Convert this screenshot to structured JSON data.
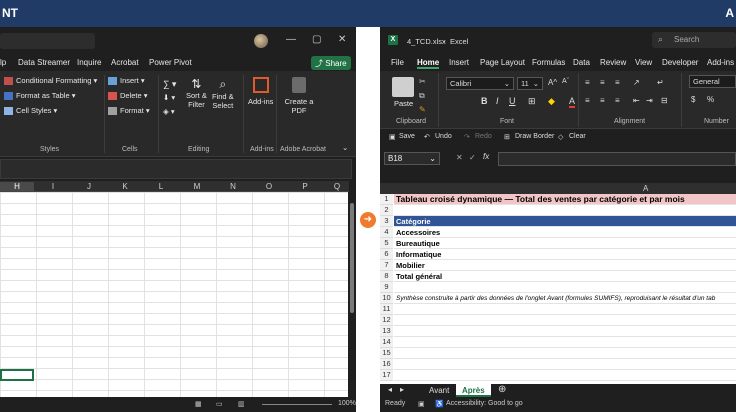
{
  "banner": {
    "left_text": "NT",
    "right_text": "A"
  },
  "left_window": {
    "menu": [
      "lp",
      "Data Streamer",
      "Inquire",
      "Acrobat",
      "Power Pivot"
    ],
    "share_label": "Share",
    "ribbon": {
      "styles_items": [
        "Conditional Formatting",
        "Format as Table",
        "Cell Styles"
      ],
      "cells_items": [
        "Insert",
        "Delete",
        "Format"
      ],
      "editing_items": [
        "Sort &",
        "Filter",
        "Find &",
        "Select"
      ],
      "addins_label": "Add-ins",
      "acrobat_label": "Create a PDF",
      "groups": [
        "Styles",
        "Cells",
        "Editing",
        "Add-ins",
        "Adobe Acrobat"
      ]
    },
    "columns": [
      "H",
      "I",
      "J",
      "K",
      "L",
      "M",
      "N",
      "O",
      "P",
      "Q"
    ],
    "status_zoom": "100%"
  },
  "right_window": {
    "filename": "4_TCD.xlsx",
    "app": "Excel",
    "search_placeholder": "Search",
    "menu": [
      "File",
      "Home",
      "Insert",
      "Page Layout",
      "Formulas",
      "Data",
      "Review",
      "View",
      "Developer",
      "Add-ins"
    ],
    "active_menu": "Home",
    "font_name": "Calibri",
    "font_size": "11",
    "number_format": "General",
    "ribbon_groups": [
      "Clipboard",
      "Font",
      "Alignment",
      "Number"
    ],
    "paste_label": "Paste",
    "qat": [
      "Save",
      "Undo",
      "Redo",
      "Draw Border",
      "Clear"
    ],
    "name_box": "B18",
    "column_a": "A",
    "rows": [
      {
        "num": "1",
        "text": "Tableau croisé dynamique — Total des ventes par catégorie et par mois"
      },
      {
        "num": "2",
        "text": ""
      },
      {
        "num": "3",
        "text": "Catégorie"
      },
      {
        "num": "4",
        "text": "Accessoires"
      },
      {
        "num": "5",
        "text": "Bureautique"
      },
      {
        "num": "6",
        "text": "Informatique"
      },
      {
        "num": "7",
        "text": "Mobilier"
      },
      {
        "num": "8",
        "text": "Total général"
      },
      {
        "num": "9",
        "text": ""
      },
      {
        "num": "10",
        "text": "Synthèse construite à partir des données de l'onglet Avant (formules SUMIFS), reproduisant le résultat d'un tab"
      },
      {
        "num": "11",
        "text": ""
      },
      {
        "num": "12",
        "text": ""
      },
      {
        "num": "13",
        "text": ""
      },
      {
        "num": "14",
        "text": ""
      },
      {
        "num": "15",
        "text": ""
      },
      {
        "num": "16",
        "text": ""
      },
      {
        "num": "17",
        "text": ""
      }
    ],
    "sheets": [
      "Avant",
      "Après"
    ],
    "active_sheet": "Après",
    "status_ready": "Ready",
    "status_accessibility": "Accessibility: Good to go"
  },
  "colors": {
    "accent": "#1e7145",
    "header_fill": "#f2c6c6",
    "category_fill": "#2f5597",
    "banner": "#1f3b66",
    "divider_button": "#f07a2e"
  }
}
